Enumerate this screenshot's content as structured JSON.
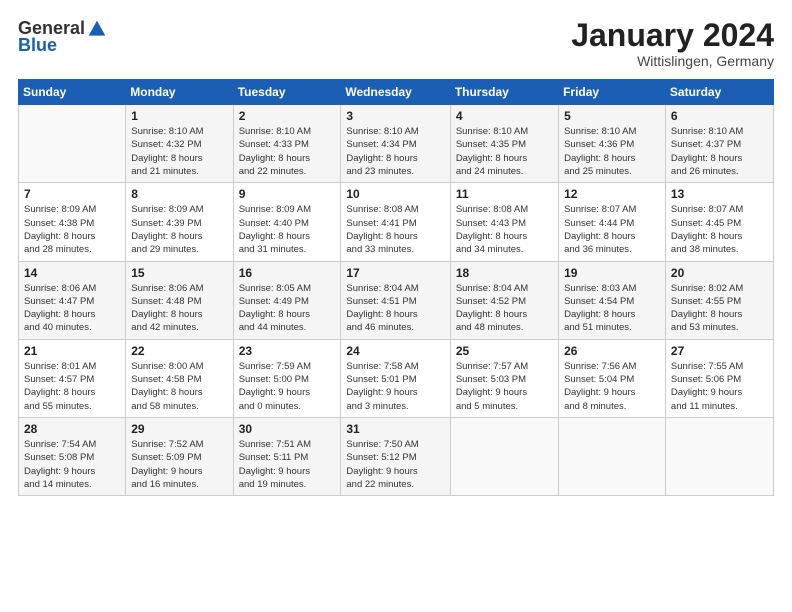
{
  "header": {
    "logo_general": "General",
    "logo_blue": "Blue",
    "month_title": "January 2024",
    "location": "Wittislingen, Germany"
  },
  "weekdays": [
    "Sunday",
    "Monday",
    "Tuesday",
    "Wednesday",
    "Thursday",
    "Friday",
    "Saturday"
  ],
  "weeks": [
    [
      {
        "day": "",
        "info": ""
      },
      {
        "day": "1",
        "info": "Sunrise: 8:10 AM\nSunset: 4:32 PM\nDaylight: 8 hours\nand 21 minutes."
      },
      {
        "day": "2",
        "info": "Sunrise: 8:10 AM\nSunset: 4:33 PM\nDaylight: 8 hours\nand 22 minutes."
      },
      {
        "day": "3",
        "info": "Sunrise: 8:10 AM\nSunset: 4:34 PM\nDaylight: 8 hours\nand 23 minutes."
      },
      {
        "day": "4",
        "info": "Sunrise: 8:10 AM\nSunset: 4:35 PM\nDaylight: 8 hours\nand 24 minutes."
      },
      {
        "day": "5",
        "info": "Sunrise: 8:10 AM\nSunset: 4:36 PM\nDaylight: 8 hours\nand 25 minutes."
      },
      {
        "day": "6",
        "info": "Sunrise: 8:10 AM\nSunset: 4:37 PM\nDaylight: 8 hours\nand 26 minutes."
      }
    ],
    [
      {
        "day": "7",
        "info": "Sunrise: 8:09 AM\nSunset: 4:38 PM\nDaylight: 8 hours\nand 28 minutes."
      },
      {
        "day": "8",
        "info": "Sunrise: 8:09 AM\nSunset: 4:39 PM\nDaylight: 8 hours\nand 29 minutes."
      },
      {
        "day": "9",
        "info": "Sunrise: 8:09 AM\nSunset: 4:40 PM\nDaylight: 8 hours\nand 31 minutes."
      },
      {
        "day": "10",
        "info": "Sunrise: 8:08 AM\nSunset: 4:41 PM\nDaylight: 8 hours\nand 33 minutes."
      },
      {
        "day": "11",
        "info": "Sunrise: 8:08 AM\nSunset: 4:43 PM\nDaylight: 8 hours\nand 34 minutes."
      },
      {
        "day": "12",
        "info": "Sunrise: 8:07 AM\nSunset: 4:44 PM\nDaylight: 8 hours\nand 36 minutes."
      },
      {
        "day": "13",
        "info": "Sunrise: 8:07 AM\nSunset: 4:45 PM\nDaylight: 8 hours\nand 38 minutes."
      }
    ],
    [
      {
        "day": "14",
        "info": "Sunrise: 8:06 AM\nSunset: 4:47 PM\nDaylight: 8 hours\nand 40 minutes."
      },
      {
        "day": "15",
        "info": "Sunrise: 8:06 AM\nSunset: 4:48 PM\nDaylight: 8 hours\nand 42 minutes."
      },
      {
        "day": "16",
        "info": "Sunrise: 8:05 AM\nSunset: 4:49 PM\nDaylight: 8 hours\nand 44 minutes."
      },
      {
        "day": "17",
        "info": "Sunrise: 8:04 AM\nSunset: 4:51 PM\nDaylight: 8 hours\nand 46 minutes."
      },
      {
        "day": "18",
        "info": "Sunrise: 8:04 AM\nSunset: 4:52 PM\nDaylight: 8 hours\nand 48 minutes."
      },
      {
        "day": "19",
        "info": "Sunrise: 8:03 AM\nSunset: 4:54 PM\nDaylight: 8 hours\nand 51 minutes."
      },
      {
        "day": "20",
        "info": "Sunrise: 8:02 AM\nSunset: 4:55 PM\nDaylight: 8 hours\nand 53 minutes."
      }
    ],
    [
      {
        "day": "21",
        "info": "Sunrise: 8:01 AM\nSunset: 4:57 PM\nDaylight: 8 hours\nand 55 minutes."
      },
      {
        "day": "22",
        "info": "Sunrise: 8:00 AM\nSunset: 4:58 PM\nDaylight: 8 hours\nand 58 minutes."
      },
      {
        "day": "23",
        "info": "Sunrise: 7:59 AM\nSunset: 5:00 PM\nDaylight: 9 hours\nand 0 minutes."
      },
      {
        "day": "24",
        "info": "Sunrise: 7:58 AM\nSunset: 5:01 PM\nDaylight: 9 hours\nand 3 minutes."
      },
      {
        "day": "25",
        "info": "Sunrise: 7:57 AM\nSunset: 5:03 PM\nDaylight: 9 hours\nand 5 minutes."
      },
      {
        "day": "26",
        "info": "Sunrise: 7:56 AM\nSunset: 5:04 PM\nDaylight: 9 hours\nand 8 minutes."
      },
      {
        "day": "27",
        "info": "Sunrise: 7:55 AM\nSunset: 5:06 PM\nDaylight: 9 hours\nand 11 minutes."
      }
    ],
    [
      {
        "day": "28",
        "info": "Sunrise: 7:54 AM\nSunset: 5:08 PM\nDaylight: 9 hours\nand 14 minutes."
      },
      {
        "day": "29",
        "info": "Sunrise: 7:52 AM\nSunset: 5:09 PM\nDaylight: 9 hours\nand 16 minutes."
      },
      {
        "day": "30",
        "info": "Sunrise: 7:51 AM\nSunset: 5:11 PM\nDaylight: 9 hours\nand 19 minutes."
      },
      {
        "day": "31",
        "info": "Sunrise: 7:50 AM\nSunset: 5:12 PM\nDaylight: 9 hours\nand 22 minutes."
      },
      {
        "day": "",
        "info": ""
      },
      {
        "day": "",
        "info": ""
      },
      {
        "day": "",
        "info": ""
      }
    ]
  ]
}
